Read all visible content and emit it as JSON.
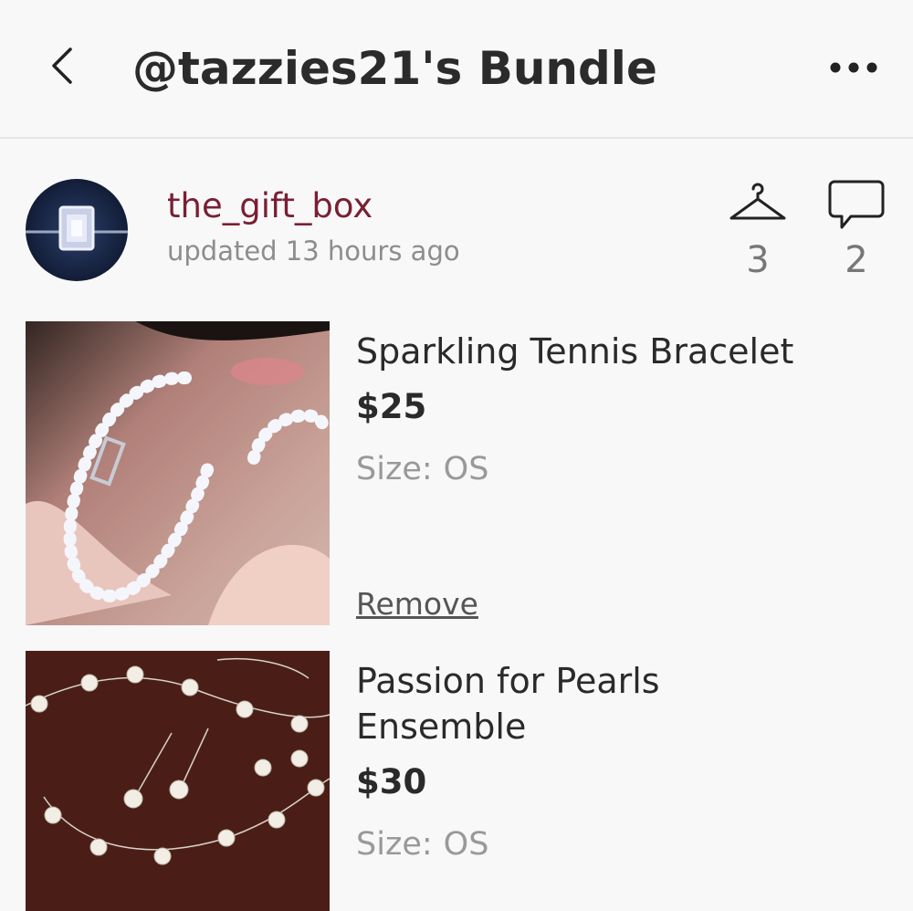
{
  "header": {
    "title": "@tazzies21's Bundle",
    "back_icon": "chevron-left-icon",
    "more_icon": "more-horizontal-icon"
  },
  "seller": {
    "username": "the_gift_box",
    "updated": "updated 13 hours ago",
    "likes_icon": "hanger-icon",
    "likes_count": "3",
    "comments_icon": "comment-icon",
    "comments_count": "2"
  },
  "items": [
    {
      "title": "Sparkling Tennis Bracelet",
      "price": "$25",
      "size_label": "Size:",
      "size_value": "OS",
      "remove_label": "Remove"
    },
    {
      "title_line1": "Passion for Pearls",
      "title_line2": "Ensemble",
      "price": "$30",
      "size_label": "Size:",
      "size_value": "OS"
    }
  ],
  "colors": {
    "seller_name": "#7a1f33",
    "muted": "#8d8d8d",
    "background": "#f8f8f9"
  }
}
